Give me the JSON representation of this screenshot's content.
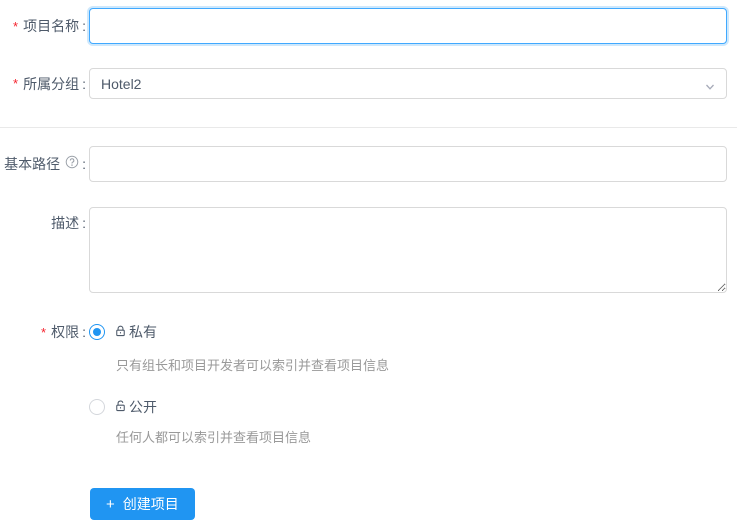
{
  "form": {
    "required_marker": "*",
    "colon": ":",
    "fields": {
      "project_name": {
        "label": "项目名称",
        "required": true,
        "value": "",
        "state": "focused"
      },
      "group": {
        "label": "所属分组",
        "required": true,
        "value": "Hotel2"
      },
      "base_path": {
        "label": "基本路径",
        "required": false,
        "value": ""
      },
      "description": {
        "label": "描述",
        "required": false,
        "value": ""
      },
      "permission": {
        "label": "权限",
        "required": true,
        "options": [
          {
            "label": "私有",
            "icon": "lock-icon",
            "selected": true,
            "description": "只有组长和项目开发者可以索引并查看项目信息"
          },
          {
            "label": "公开",
            "icon": "unlock-icon",
            "selected": false,
            "description": "任何人都可以索引并查看项目信息"
          }
        ]
      }
    },
    "submit_button": {
      "plus_glyph": "+",
      "label": "创建项目"
    },
    "icons": {
      "group_select": "chevron-down-icon",
      "base_path_help": "question-circle-icon",
      "submit": "plus-icon"
    },
    "colors": {
      "accent": "#2095f2",
      "focus_border": "#40a9ff",
      "focus_shadow": "rgba(32,149,242,0.22)",
      "required": "#f5222d",
      "label_text": "#4e5a6a",
      "help_text": "#999999",
      "input_border": "#d9d9d9",
      "divider": "#e9e9e9"
    }
  }
}
